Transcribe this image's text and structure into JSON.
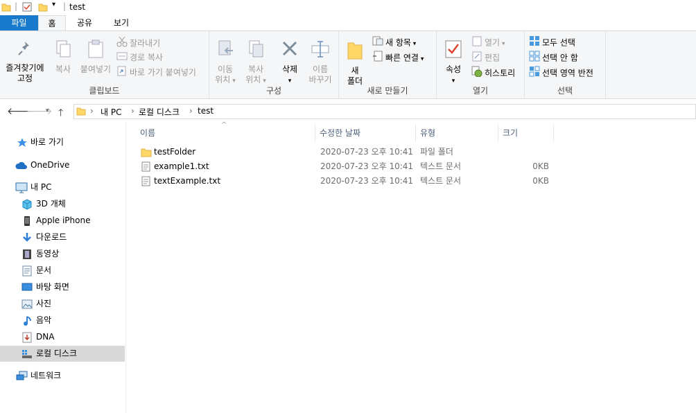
{
  "window": {
    "title": "test"
  },
  "ribbon_tabs": [
    "파일",
    "홈",
    "공유",
    "보기"
  ],
  "ribbon": {
    "clipboard": {
      "label": "클립보드",
      "pin": [
        "즐겨찾기에",
        "고정"
      ],
      "copy": "복사",
      "paste": "붙여넣기",
      "cut": "잘라내기",
      "copy_path": "경로 복사",
      "paste_shortcut": "바로 가기 붙여넣기"
    },
    "organize": {
      "label": "구성",
      "move": [
        "이동",
        "위치"
      ],
      "copyto": [
        "복사",
        "위치"
      ],
      "delete": "삭제",
      "rename": [
        "이름",
        "바꾸기"
      ]
    },
    "new": {
      "label": "새로 만들기",
      "new_folder": [
        "새",
        "폴더"
      ],
      "new_item": "새 항목",
      "easy_access": "빠른 연결"
    },
    "open": {
      "label": "열기",
      "properties": "속성",
      "open": "열기",
      "edit": "편집",
      "history": "히스토리"
    },
    "select": {
      "label": "선택",
      "select_all": "모두 선택",
      "select_none": "선택 안 함",
      "invert": "선택 영역 반전"
    }
  },
  "breadcrumb": [
    "내 PC",
    "로컬 디스크",
    "test"
  ],
  "nav_items": [
    {
      "label": "바로 가기",
      "icon": "star-icon"
    },
    {
      "label": "OneDrive",
      "icon": "cloud-icon"
    },
    {
      "label": "내 PC",
      "icon": "computer-icon"
    },
    {
      "label": "3D 개체",
      "icon": "cube-icon"
    },
    {
      "label": "Apple iPhone",
      "icon": "phone-icon"
    },
    {
      "label": "다운로드",
      "icon": "download-icon"
    },
    {
      "label": "동영상",
      "icon": "video-icon"
    },
    {
      "label": "문서",
      "icon": "document-icon"
    },
    {
      "label": "바탕 화면",
      "icon": "desktop-icon"
    },
    {
      "label": "사진",
      "icon": "picture-icon"
    },
    {
      "label": "음악",
      "icon": "music-icon"
    },
    {
      "label": "DNA",
      "icon": "drive-icon"
    },
    {
      "label": "로컬 디스크",
      "icon": "disk-icon",
      "selected": true
    },
    {
      "label": "네트워크",
      "icon": "network-icon"
    }
  ],
  "columns": [
    "이름",
    "수정한 날짜",
    "유형",
    "크기"
  ],
  "files": [
    {
      "name": "testFolder",
      "date": "2020-07-23 오후 10:41",
      "type": "파일 폴더",
      "size": "",
      "icon": "folder-icon"
    },
    {
      "name": "example1.txt",
      "date": "2020-07-23 오후 10:41",
      "type": "텍스트 문서",
      "size": "0KB",
      "icon": "text-file-icon"
    },
    {
      "name": "textExample.txt",
      "date": "2020-07-23 오후 10:41",
      "type": "텍스트 문서",
      "size": "0KB",
      "icon": "text-file-icon"
    }
  ],
  "colors": {
    "file_tab": "#1979ca",
    "ribbon_bg": "#f5f6f7",
    "selected_nav": "#d9d9d9",
    "folder": "#ffd766"
  }
}
